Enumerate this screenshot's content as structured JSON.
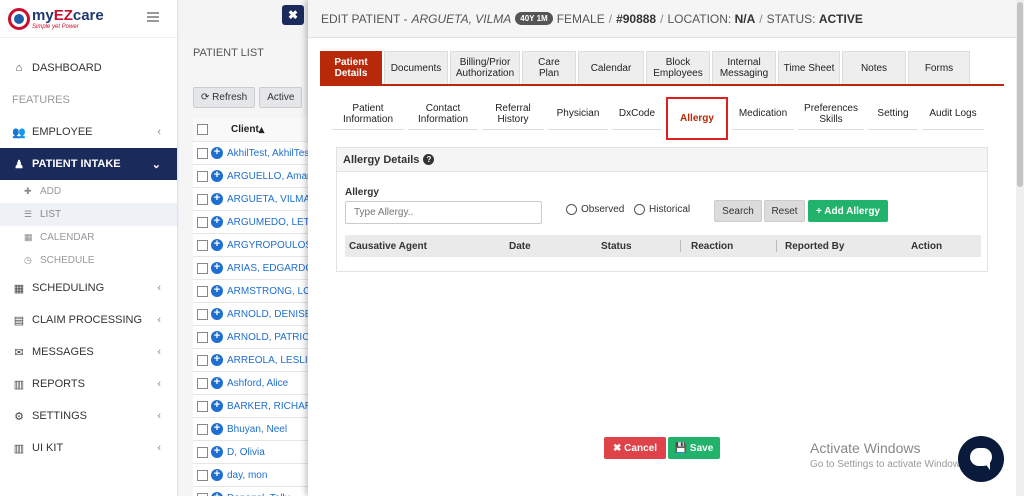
{
  "logo": {
    "name_my": "my",
    "name_ez": "EZ",
    "name_care": "care",
    "tagline": "Simple yet Power"
  },
  "sidebar": {
    "items": [
      {
        "label": "DASHBOARD",
        "icon": "home-icon"
      },
      {
        "section": "FEATURES"
      },
      {
        "label": "EMPLOYEE",
        "icon": "users-icon"
      },
      {
        "label": "PATIENT INTAKE",
        "icon": "user-icon",
        "active": true
      },
      {
        "label": "SCHEDULING",
        "icon": "calendar-icon"
      },
      {
        "label": "CLAIM PROCESSING",
        "icon": "file-icon"
      },
      {
        "label": "MESSAGES",
        "icon": "envelope-icon"
      },
      {
        "label": "REPORTS",
        "icon": "bar-chart-icon"
      },
      {
        "label": "SETTINGS",
        "icon": "gear-icon"
      },
      {
        "label": "UI KIT",
        "icon": "bar-chart-icon"
      }
    ],
    "sub_items": [
      {
        "label": "ADD",
        "icon": "plus-icon"
      },
      {
        "label": "LIST",
        "icon": "list-icon"
      },
      {
        "label": "CALENDAR",
        "icon": "calendar-icon"
      },
      {
        "label": "SCHEDULE",
        "icon": "clock-icon"
      }
    ]
  },
  "patient_list": {
    "title": "PATIENT LIST",
    "refresh_label": "Refresh",
    "active_label": "Active",
    "column_client": "Client",
    "rows": [
      "AkhilTest, AkhilTest",
      "ARGUELLO, Amanda",
      "ARGUETA, VILMA",
      "ARGUMEDO, LETICIA",
      "ARGYROPOULOS",
      "ARIAS, EDGARDO",
      "ARMSTRONG, LORI",
      "ARNOLD, DENISE",
      "ARNOLD, PATRICIA",
      "ARREOLA, LESLIE",
      "Ashford, Alice",
      "BARKER, RICHARD",
      "Bhuyan, Neel",
      "D, Olivia",
      "day, mon",
      "Denegal, Tally"
    ]
  },
  "modal": {
    "prefix": "EDIT PATIENT - ",
    "patient_name": "ARGUETA, VILMA",
    "age": "40Y 1M",
    "gender": "FEMALE",
    "patient_id": "#90888",
    "location_label": "LOCATION:",
    "location_value": "N/A",
    "status_label": "STATUS:",
    "status_value": "ACTIVE",
    "close_icon": "close-icon",
    "accent": "#b8290a",
    "top_tabs": [
      {
        "label": "Patient Details",
        "active": true
      },
      {
        "label": "Documents"
      },
      {
        "label": "Billing/Prior Authorization"
      },
      {
        "label": "Care Plan"
      },
      {
        "label": "Calendar"
      },
      {
        "label": "Block Employees"
      },
      {
        "label": "Internal Messaging"
      },
      {
        "label": "Time Sheet"
      },
      {
        "label": "Notes"
      },
      {
        "label": "Forms"
      }
    ],
    "sub_tabs": [
      {
        "label": "Patient Information"
      },
      {
        "label": "Contact Information"
      },
      {
        "label": "Referral History"
      },
      {
        "label": "Physician"
      },
      {
        "label": "DxCode"
      },
      {
        "label": "Allergy",
        "active": true
      },
      {
        "label": "Medication"
      },
      {
        "label": "Preferences Skills"
      },
      {
        "label": "Setting"
      },
      {
        "label": "Audit Logs"
      }
    ],
    "allergy": {
      "panel_title": "Allergy Details",
      "field_label": "Allergy",
      "input_placeholder": "Type Allergy..",
      "radio_observed": "Observed",
      "radio_historical": "Historical",
      "search_label": "Search",
      "reset_label": "Reset",
      "add_label": "+ Add Allergy",
      "columns": [
        "Causative Agent",
        "Date",
        "Status",
        "Reaction",
        "Reported By",
        "Action"
      ]
    },
    "cancel_label": "✖ Cancel",
    "save_label": "💾 Save"
  },
  "watermark": {
    "title": "Activate Windows",
    "subtitle": "Go to Settings to activate Windows."
  }
}
